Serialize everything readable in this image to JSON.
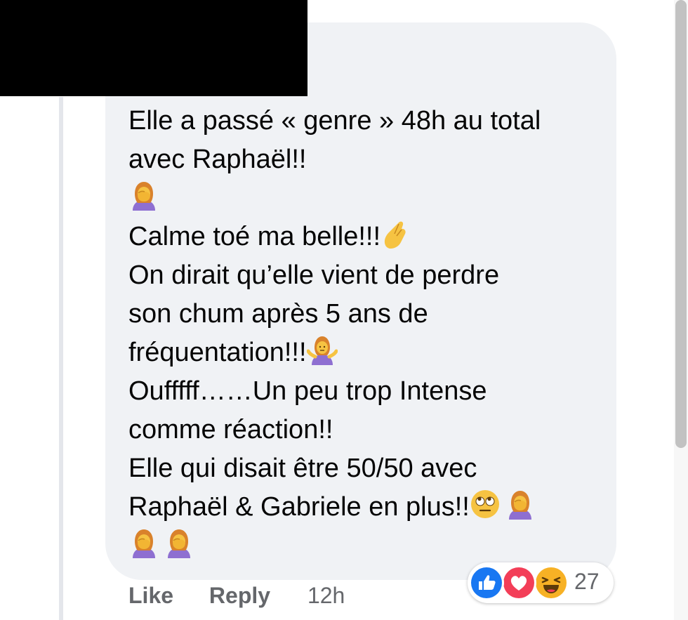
{
  "comment": {
    "lines": [
      {
        "text": "Elle a passé « genre » 48h au total",
        "emojis": []
      },
      {
        "text": "avec Raphaël!!",
        "emojis": []
      },
      {
        "text": "",
        "emojis": [
          "woman-facepalming"
        ]
      },
      {
        "text": "Calme toé ma belle!!!",
        "emojis": [
          "pinched-fingers"
        ]
      },
      {
        "text": "On dirait qu’elle vient de perdre",
        "emojis": []
      },
      {
        "text": "son chum après 5 ans de",
        "emojis": []
      },
      {
        "text": "fréquentation!!!",
        "emojis": [
          "woman-shrugging"
        ]
      },
      {
        "text": "Oufffff……Un peu trop Intense",
        "emojis": []
      },
      {
        "text": "comme réaction!!",
        "emojis": []
      },
      {
        "text": "Elle qui disait être 50/50 avec",
        "emojis": []
      },
      {
        "text": "Raphaël & Gabriele en plus!!",
        "emojis": [
          "face-with-rolling-eyes",
          "woman-facepalming"
        ]
      },
      {
        "text": "",
        "emojis": [
          "woman-facepalming",
          "woman-facepalming"
        ]
      }
    ]
  },
  "actions": {
    "like_label": "Like",
    "reply_label": "Reply",
    "timestamp": "12h"
  },
  "reactions": {
    "icons": [
      "like-icon",
      "love-icon",
      "haha-icon"
    ],
    "count": "27",
    "colors": {
      "like": "#1877f2",
      "love": "#f33e58",
      "haha": "#f7b125"
    }
  },
  "colors": {
    "bubble": "#f0f2f5",
    "text": "#050505",
    "secondary_text": "#65676b"
  }
}
